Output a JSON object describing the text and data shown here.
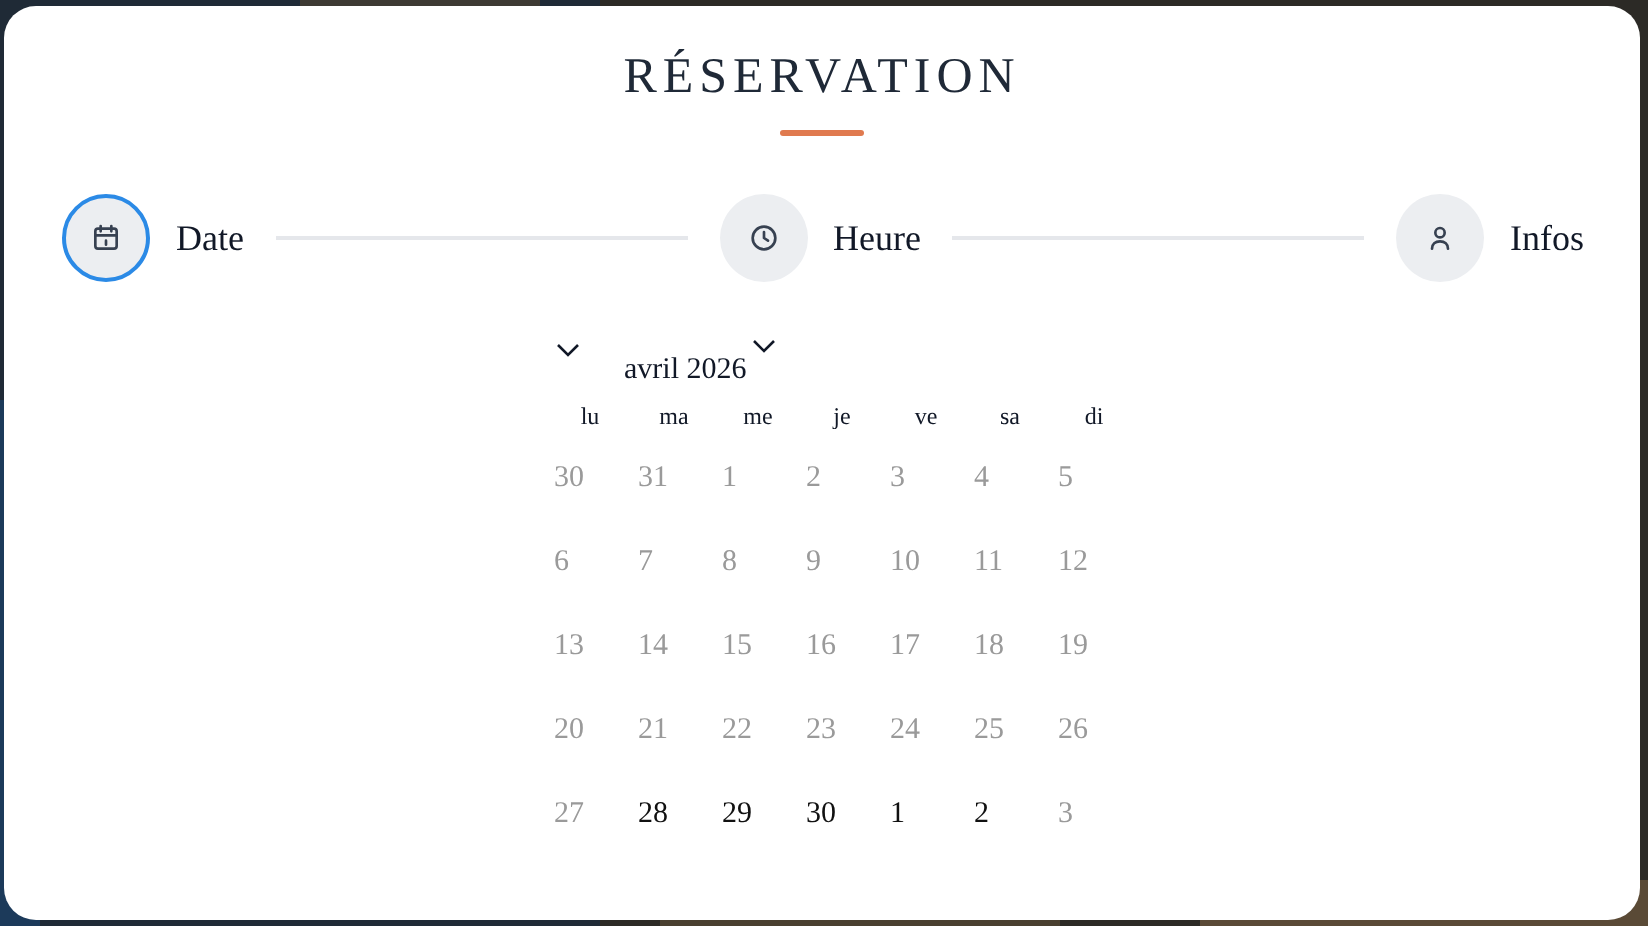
{
  "title": "RÉSERVATION",
  "steps": [
    {
      "kind": "date",
      "label": "Date",
      "selected": true
    },
    {
      "kind": "time",
      "label": "Heure",
      "selected": false
    },
    {
      "kind": "info",
      "label": "Infos",
      "selected": false
    }
  ],
  "calendar": {
    "month": "avril 2026",
    "weekdays": [
      "lu",
      "ma",
      "me",
      "je",
      "ve",
      "sa",
      "di"
    ],
    "days": [
      {
        "label": "30",
        "disabled": true
      },
      {
        "label": "31",
        "disabled": true
      },
      {
        "label": "1",
        "disabled": true
      },
      {
        "label": "2",
        "disabled": true
      },
      {
        "label": "3",
        "disabled": true
      },
      {
        "label": "4",
        "disabled": true
      },
      {
        "label": "5",
        "disabled": true
      },
      {
        "label": "6",
        "disabled": true
      },
      {
        "label": "7",
        "disabled": true
      },
      {
        "label": "8",
        "disabled": true
      },
      {
        "label": "9",
        "disabled": true
      },
      {
        "label": "10",
        "disabled": true
      },
      {
        "label": "11",
        "disabled": true
      },
      {
        "label": "12",
        "disabled": true
      },
      {
        "label": "13",
        "disabled": true
      },
      {
        "label": "14",
        "disabled": true
      },
      {
        "label": "15",
        "disabled": true
      },
      {
        "label": "16",
        "disabled": true
      },
      {
        "label": "17",
        "disabled": true
      },
      {
        "label": "18",
        "disabled": true
      },
      {
        "label": "19",
        "disabled": true
      },
      {
        "label": "20",
        "disabled": true
      },
      {
        "label": "21",
        "disabled": true
      },
      {
        "label": "22",
        "disabled": true
      },
      {
        "label": "23",
        "disabled": true
      },
      {
        "label": "24",
        "disabled": true
      },
      {
        "label": "25",
        "disabled": true
      },
      {
        "label": "26",
        "disabled": true
      },
      {
        "label": "27",
        "disabled": true
      },
      {
        "label": "28",
        "disabled": false
      },
      {
        "label": "29",
        "disabled": false
      },
      {
        "label": "30",
        "disabled": false
      },
      {
        "label": "1",
        "disabled": false
      },
      {
        "label": "2",
        "disabled": false
      },
      {
        "label": "3",
        "disabled": true
      }
    ]
  }
}
